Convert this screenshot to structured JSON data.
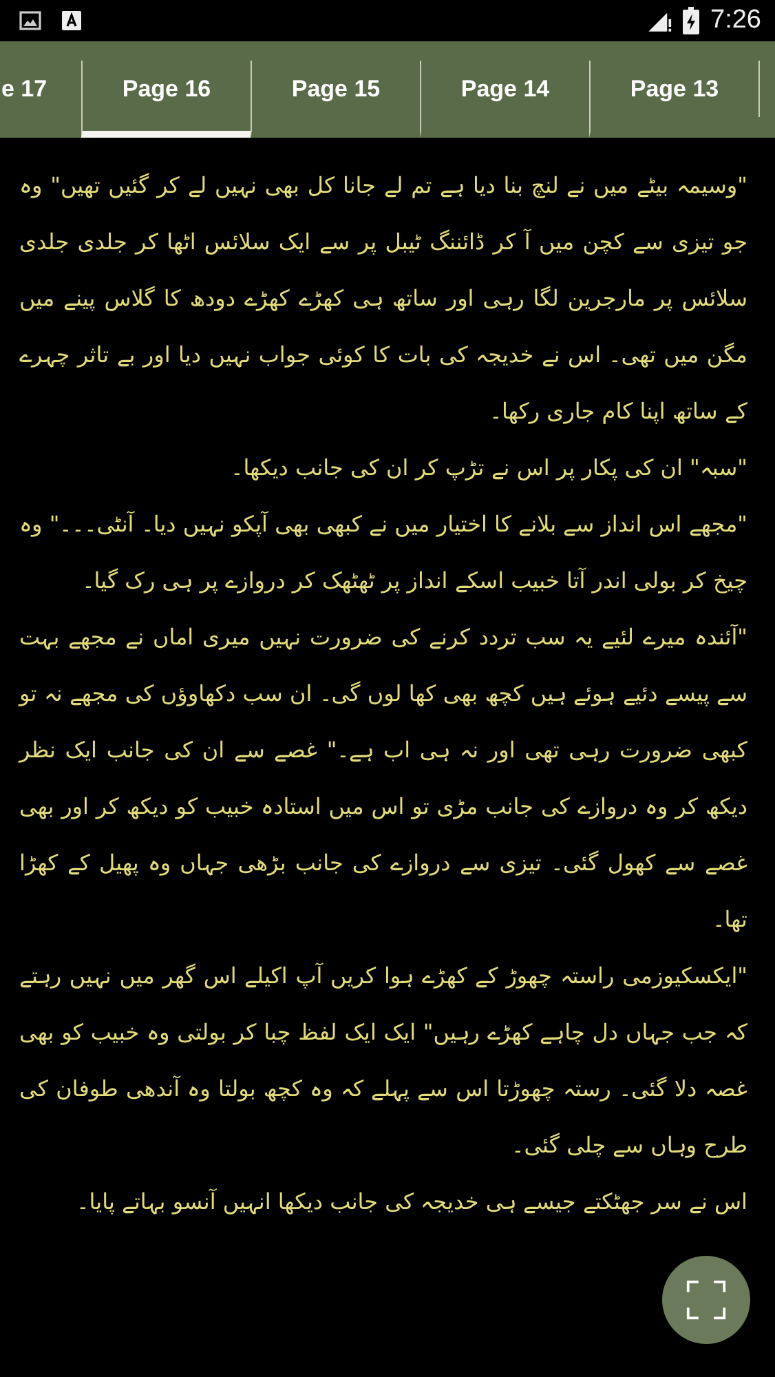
{
  "status_bar": {
    "time": "7:26"
  },
  "tabs": [
    {
      "label": "Page 13",
      "selected": false
    },
    {
      "label": "Page 14",
      "selected": false
    },
    {
      "label": "Page 15",
      "selected": false
    },
    {
      "label": "Page 16",
      "selected": true
    },
    {
      "label": "e 17",
      "selected": false
    }
  ],
  "paragraphs": [
    "\"وسیمہ بیٹے میں نے لنچ بنا دیا ہے تم لے جانا کل بھی نہیں لے کر گئیں تھیں\" وہ جو تیزی سے کچن میں آ کر ڈائننگ ٹیبل پر سے ایک سلائس اٹھا کر جلدی جلدی سلائس پر مارجرین لگا رہی اور ساتھ ہی کھڑے کھڑے دودھ کا گلاس پینے میں مگن میں تھی۔ اس نے خدیجہ کی بات کا کوئی جواب نہیں دیا اور بے تاثر چہرے کے ساتھ اپنا کام جاری رکھا۔",
    "\"سبہ\" ان کی پکار پر اس نے تڑپ کر ان کی جانب دیکھا۔",
    "\"مجھے اس انداز سے بلانے کا اختیار میں نے کبھی بھی آپکو نہیں دیا۔ آنٹی۔۔۔\" وہ چیخ کر بولی اندر آتا خبیب اسکے انداز پر ٹھٹھک کر دروازے پر ہی رک گیا۔",
    "\"آئندہ میرے لئیے یہ سب تردد کرنے کی ضرورت نہیں میری اماں نے مجھے بہت سے پیسے دئیے ہوئے ہیں کچھ بھی کھا لوں گی۔ ان سب دکھاوؤں کی مجھے نہ تو کبھی ضرورت رہی تھی اور نہ ہی اب ہے۔\" غصے سے ان کی جانب ایک نظر دیکھ کر وہ دروازے کی جانب مڑی تو اس میں استادہ خبیب کو دیکھ کر اور بھی غصے سے کھول گئی۔ تیزی سے دروازے کی جانب بڑھی جہاں وہ پھیل کے کھڑا تھا۔",
    "\"ایکسکیوزمی راستہ چھوڑ کے کھڑے ہوا کریں آپ اکیلے اس گھر میں نہیں رہتے کہ جب جہاں دل چاہے کھڑے رہیں\" ایک ایک لفظ چبا کر بولتی وہ خبیب کو بھی غصہ دلا گئی۔ رستہ چھوڑتا اس سے پہلے کہ وہ کچھ بولتا وہ آندھی طوفان کی طرح وہاں سے چلی گئی۔",
    "اس نے سر جھٹکتے جیسے ہی خدیجہ کی جانب دیکھا انہیں آنسو بہاتے پایا۔"
  ]
}
